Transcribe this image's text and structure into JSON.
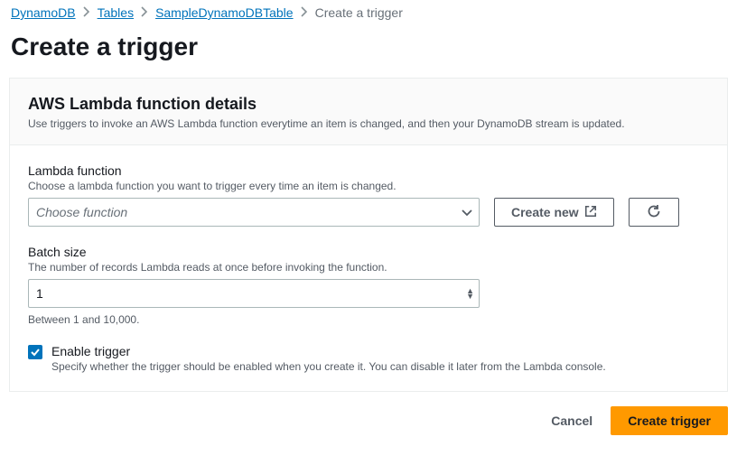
{
  "breadcrumb": {
    "items": [
      {
        "label": "DynamoDB"
      },
      {
        "label": "Tables"
      },
      {
        "label": "SampleDynamoDBTable"
      }
    ],
    "current": "Create a trigger"
  },
  "page_title": "Create a trigger",
  "panel": {
    "title": "AWS Lambda function details",
    "desc": "Use triggers to invoke an AWS Lambda function everytime an item is changed, and then your DynamoDB stream is updated."
  },
  "lambda_field": {
    "label": "Lambda function",
    "desc": "Choose a lambda function you want to trigger every time an item is changed.",
    "placeholder": "Choose function",
    "create_new_label": "Create new"
  },
  "batch_field": {
    "label": "Batch size",
    "desc": "The number of records Lambda reads at once before invoking the function.",
    "value": "1",
    "hint": "Between 1 and 10,000."
  },
  "enable_trigger": {
    "label": "Enable trigger",
    "desc": "Specify whether the trigger should be enabled when you create it. You can disable it later from the Lambda console."
  },
  "footer": {
    "cancel_label": "Cancel",
    "create_label": "Create trigger"
  }
}
